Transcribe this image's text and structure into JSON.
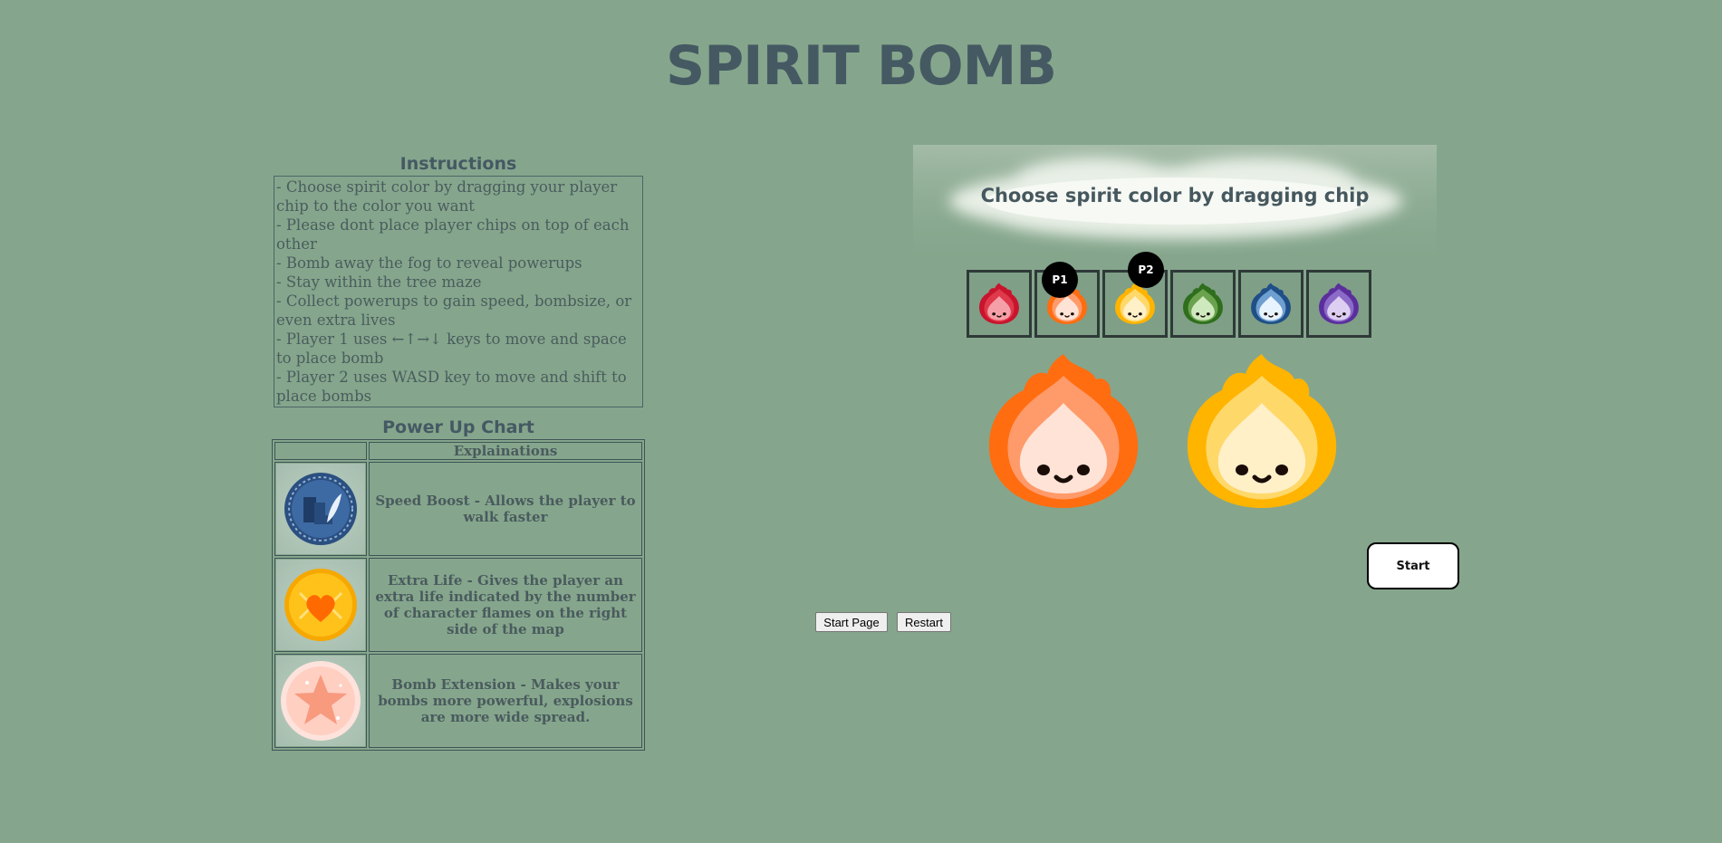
{
  "title": "SPIRIT BOMB",
  "instructions": {
    "heading": "Instructions",
    "lines": [
      "- Choose spirit color by dragging your player chip to the color you want",
      "- Please dont place player chips on top of each other",
      "- Bomb away the fog to reveal powerups",
      "- Stay within the tree maze",
      "- Collect powerups to gain speed, bombsize, or even extra lives",
      "- Player 1 uses ←↑→↓ keys to move and space to place bomb",
      "- Player 2 uses WASD key to move and shift to place bombs"
    ]
  },
  "powerups": {
    "heading": "Power Up Chart",
    "column_header": "Explainations",
    "rows": [
      {
        "icon": "speed-boost-icon",
        "text": "Speed Boost - Allows the player to walk faster"
      },
      {
        "icon": "extra-life-icon",
        "text": "Extra Life - Gives the player an extra life indicated by the number of character flames on the right side of the map"
      },
      {
        "icon": "bomb-extension-icon",
        "text": "Bomb Extension - Makes your bombs more powerful, explosions are more wide spread."
      }
    ]
  },
  "game": {
    "banner": "Choose spirit color by dragging chip",
    "chips": [
      {
        "color": "red",
        "body": "#c8142c",
        "light": "#e0394c",
        "face": "#f5a0a8"
      },
      {
        "color": "orange",
        "body": "#ff6d10",
        "light": "#ff9a6a",
        "face": "#ffe3d6"
      },
      {
        "color": "yellow",
        "body": "#ffb400",
        "light": "#ffd86a",
        "face": "#fff0c8"
      },
      {
        "color": "green",
        "body": "#2e6e1c",
        "light": "#6ba24e",
        "face": "#cfe9bf"
      },
      {
        "color": "blue",
        "body": "#1f4f86",
        "light": "#6e9fd0",
        "face": "#e7f3ff"
      },
      {
        "color": "purple",
        "body": "#5a2f9c",
        "light": "#8c6bc8",
        "face": "#dccff2"
      }
    ],
    "player1_badge": "P1",
    "player2_badge": "P2",
    "player1_color": "orange",
    "player2_color": "yellow",
    "start_label": "Start"
  },
  "buttons": {
    "start_page": "Start Page",
    "restart": "Restart"
  }
}
